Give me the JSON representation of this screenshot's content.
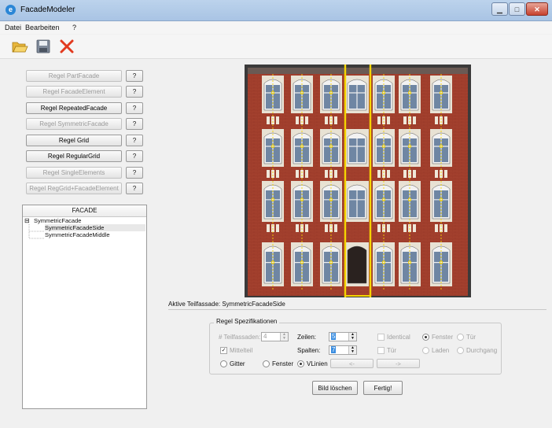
{
  "window": {
    "title": "FacadeModeler",
    "app_icon": "app-globe-icon",
    "controls": {
      "minimize": "minimize-icon",
      "maximize": "maximize-icon",
      "close": "close-icon"
    }
  },
  "menu": {
    "items": [
      "Datei",
      "Bearbeiten",
      "?"
    ]
  },
  "toolbar": {
    "icons": [
      "folder-open-icon",
      "save-disk-icon",
      "delete-x-icon"
    ]
  },
  "rules": {
    "help_label": "?",
    "items": [
      {
        "label": "Regel PartFacade",
        "enabled": false
      },
      {
        "label": "Regel FacadeElement",
        "enabled": false
      },
      {
        "label": "Regel RepeatedFacade",
        "enabled": true
      },
      {
        "label": "Regel SymmetricFacade",
        "enabled": false
      },
      {
        "label": "Regel Grid",
        "enabled": true
      },
      {
        "label": "Regel RegularGrid",
        "enabled": true
      },
      {
        "label": "Regel SingleElements",
        "enabled": false
      },
      {
        "label": "Regel RegGrid+FacadeElement",
        "enabled": false
      }
    ]
  },
  "tree": {
    "header": "FACADE",
    "expander": "⊟",
    "root": "SymmetricFacade",
    "children": [
      "SymmetricFacadeSide",
      "SymmetricFacadeMiddle"
    ],
    "selected_child": "SymmetricFacadeSide"
  },
  "image": {
    "description_icon": "facade-photo",
    "brick_color": "#a4412e",
    "guide_line_color": "#f5d400"
  },
  "active_label": "Aktive Teilfassade: SymmetricFacadeSide",
  "spec": {
    "group_title": "Regel Spezifikationen",
    "teilfassaden_label": "# Teilfassaden:",
    "teilfassaden_value": "4",
    "zeilen_label": "Zeilen:",
    "zeilen_value": "5",
    "spalten_label": "Spalten:",
    "spalten_value": "7",
    "mittelteil_label": "Mittelteil",
    "mittelteil_checked": true,
    "identical_label": "Identical",
    "tuer_check_label": "Tür",
    "gitter_label": "Gitter",
    "fenster_radio_label": "Fenster",
    "vlinien_label": "VLinien",
    "back_btn": "<-",
    "fwd_btn": "->",
    "fenster_right_label": "Fenster",
    "tuer_right_label": "Tür",
    "laden_label": "Laden",
    "durchgang_label": "Durchgang"
  },
  "buttons": {
    "clear": "Bild löschen",
    "done": "Fertig!"
  }
}
